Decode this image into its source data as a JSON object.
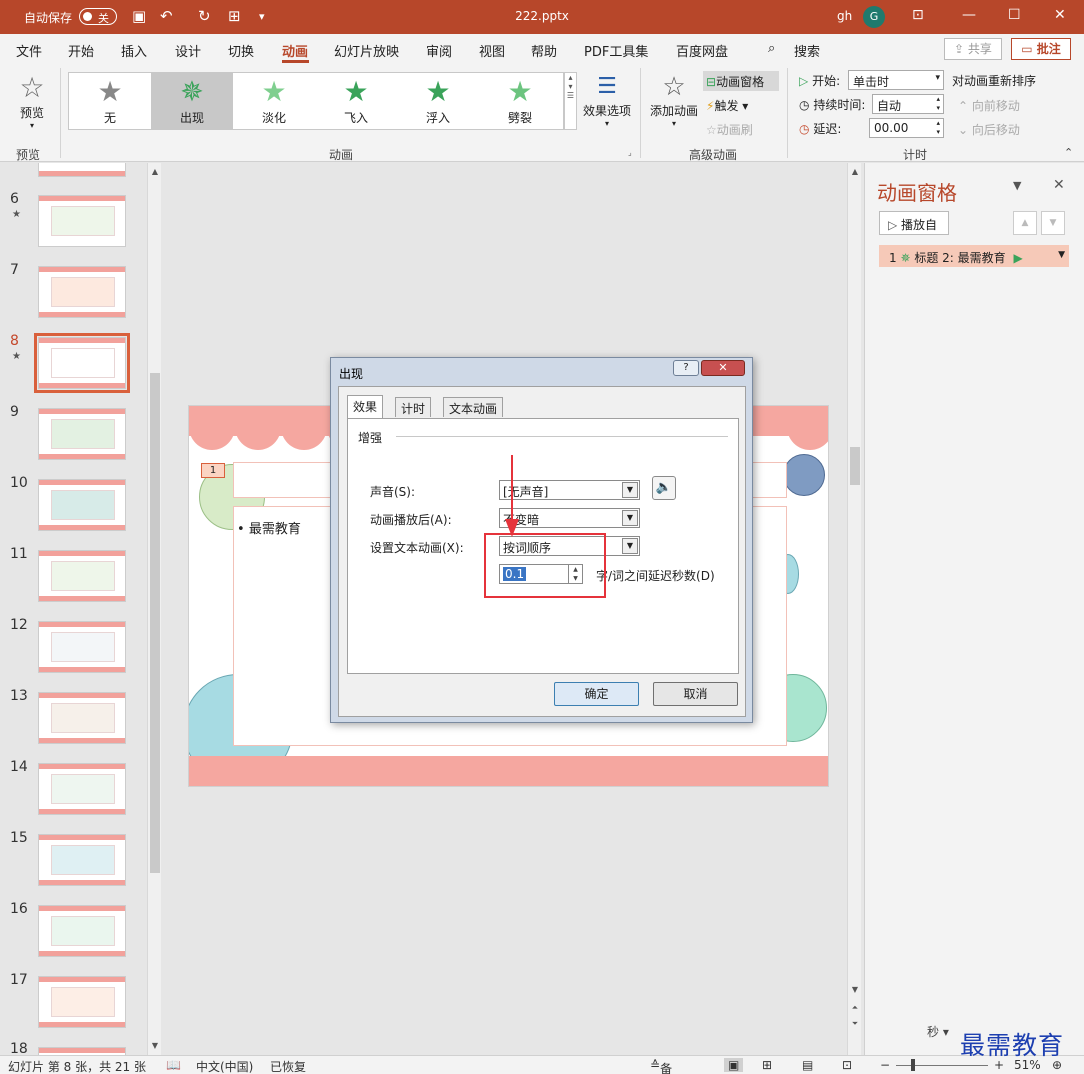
{
  "titlebar": {
    "autosave_label": "自动保存",
    "autosave_state": "关",
    "document_name": "222.pptx",
    "user_name": "gh",
    "avatar_letter": "G",
    "accent_color": "#b7472a"
  },
  "menu": {
    "tabs": [
      "文件",
      "开始",
      "插入",
      "设计",
      "切换",
      "动画",
      "幻灯片放映",
      "审阅",
      "视图",
      "帮助",
      "PDF工具集",
      "百度网盘"
    ],
    "active_tab": "动画",
    "search_label": "搜索",
    "share_label": "共享",
    "comment_label": "批注"
  },
  "ribbon": {
    "preview_label": "预览",
    "preview_group": "预览",
    "gallery": [
      "无",
      "出现",
      "淡化",
      "飞入",
      "浮入",
      "劈裂"
    ],
    "selected_effect": "出现",
    "effect_options_label": "效果选项",
    "animation_group": "动画",
    "add_animation_label": "添加动画",
    "animation_pane_label": "动画窗格",
    "trigger_label": "触发",
    "animation_painter_label": "动画刷",
    "advanced_group": "高级动画",
    "start_label": "开始:",
    "start_value": "单击时",
    "duration_label": "持续时间:",
    "duration_value": "自动",
    "delay_label": "延迟:",
    "delay_value": "00.00",
    "reorder_title": "对动画重新排序",
    "move_earlier": "向前移动",
    "move_later": "向后移动",
    "timing_group": "计时"
  },
  "thumbnails": {
    "numbers": [
      "6",
      "7",
      "8",
      "9",
      "10",
      "11",
      "12",
      "13",
      "14",
      "15",
      "16",
      "17",
      "18"
    ],
    "active": "8"
  },
  "slide": {
    "tag": "1",
    "bullet_text": "最需教育"
  },
  "dialog": {
    "title": "出现",
    "help": "?",
    "tabs": [
      "效果",
      "计时",
      "文本动画"
    ],
    "active_tab": "效果",
    "section": "增强",
    "sound_label": "声音(S):",
    "sound_value": "[无声音]",
    "after_label": "动画播放后(A):",
    "after_value": "不变暗",
    "text_anim_label": "设置文本动画(X):",
    "text_anim_value": "按词顺序",
    "delay_value": "0.1",
    "delay_suffix": "字/词之间延迟秒数(D)",
    "ok": "确定",
    "cancel": "取消"
  },
  "anim_pane": {
    "title": "动画窗格",
    "play_label": "播放自",
    "item_label": "标题 2: 最需教育",
    "item_index": "1",
    "seconds_label": "秒"
  },
  "status": {
    "slide_info": "幻灯片 第 8 张，共 21 张",
    "language": "中文(中国)",
    "recovered": "已恢复",
    "notes": "备注",
    "zoom": "51%"
  },
  "watermark": "最需教育"
}
